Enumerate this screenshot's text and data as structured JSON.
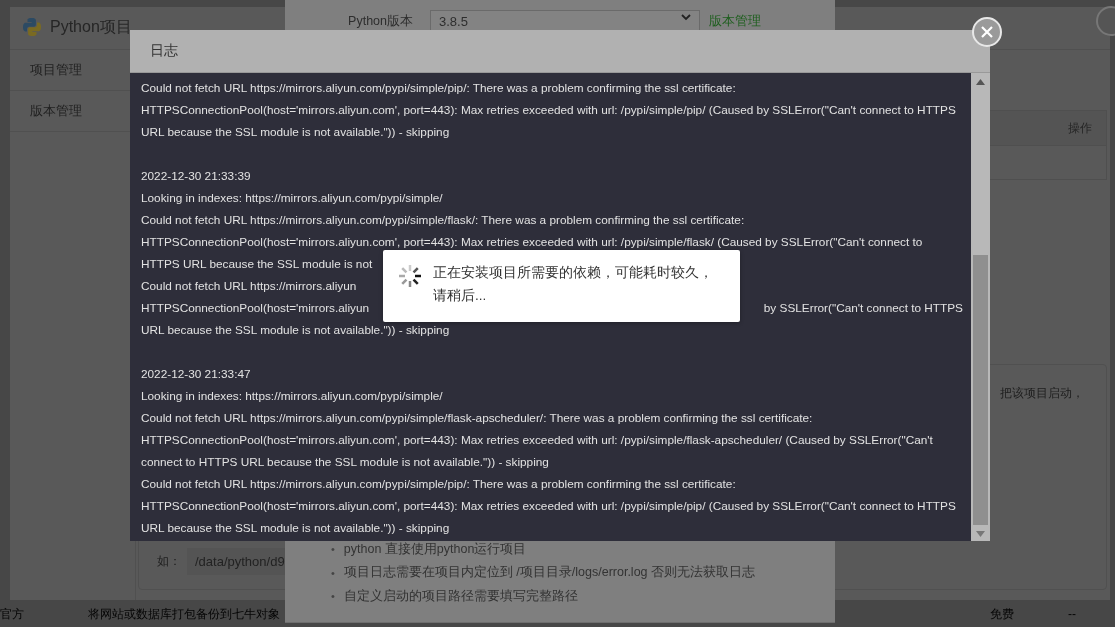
{
  "background_page": {
    "bottom_row": [
      "官方",
      "将网站或数据库打包备份到七牛对象",
      "免费",
      "--"
    ]
  },
  "manager_window": {
    "title": "Python项目",
    "sidebar": [
      {
        "label": "项目管理"
      },
      {
        "label": "版本管理"
      }
    ],
    "table": {
      "columns": [
        "操作"
      ]
    },
    "notice": "把该项目启动，",
    "path_example": {
      "label": "如：",
      "value": "/data/python/d9"
    }
  },
  "add_dialog": {
    "python_version": {
      "label": "Python版本",
      "value": "3.8.5"
    },
    "version_link": "版本管理",
    "tips": [
      {
        "bullet": "•",
        "text": "python 直接使用python运行项目"
      },
      {
        "bullet": "•",
        "text": "项目日志需要在项目内定位到 /项目目录/logs/error.log 否则无法获取日志"
      },
      {
        "bullet": "•",
        "text": "自定义启动的项目路径需要填写完整路径"
      }
    ]
  },
  "log_dialog": {
    "title": "日志",
    "blocks": [
      {
        "lines": [
          {
            "kind": "full",
            "text": "Could not fetch URL https://mirrors.aliyun.com/pypi/simple/pip/: There was a problem confirming the ssl certificate:"
          },
          {
            "kind": "full",
            "text": "HTTPSConnectionPool(host='mirrors.aliyun.com', port=443): Max retries exceeded with url: /pypi/simple/pip/ (Caused by SSLError(\"Can't connect to HTTPS"
          },
          {
            "kind": "full",
            "text": "URL because the SSL module is not available.\")) - skipping"
          }
        ]
      },
      {
        "lines": [
          {
            "kind": "full",
            "text": "2022-12-30 21:33:39"
          },
          {
            "kind": "full",
            "text": "Looking in indexes: https://mirrors.aliyun.com/pypi/simple/"
          },
          {
            "kind": "full",
            "text": "Could not fetch URL https://mirrors.aliyun.com/pypi/simple/flask/: There was a problem confirming the ssl certificate:"
          },
          {
            "kind": "full",
            "text": "HTTPSConnectionPool(host='mirrors.aliyun.com', port=443): Max retries exceeded with url: /pypi/simple/flask/ (Caused by SSLError(\"Can't connect to"
          },
          {
            "kind": "split",
            "left": "HTTPS URL because the SSL module is not"
          },
          {
            "kind": "split",
            "left": "Could not fetch URL https://mirrors.aliyun"
          },
          {
            "kind": "split",
            "left": "HTTPSConnectionPool(host='mirrors.aliyun",
            "right": "by SSLError(\"Can't connect to HTTPS"
          },
          {
            "kind": "full",
            "text": "URL because the SSL module is not available.\")) - skipping"
          }
        ]
      },
      {
        "lines": [
          {
            "kind": "full",
            "text": "2022-12-30 21:33:47"
          },
          {
            "kind": "full",
            "text": "Looking in indexes: https://mirrors.aliyun.com/pypi/simple/"
          },
          {
            "kind": "full",
            "text": "Could not fetch URL https://mirrors.aliyun.com/pypi/simple/flask-apscheduler/: There was a problem confirming the ssl certificate:"
          },
          {
            "kind": "full",
            "text": "HTTPSConnectionPool(host='mirrors.aliyun.com', port=443): Max retries exceeded with url: /pypi/simple/flask-apscheduler/ (Caused by SSLError(\"Can't"
          },
          {
            "kind": "full",
            "text": "connect to HTTPS URL because the SSL module is not available.\")) - skipping"
          },
          {
            "kind": "full",
            "text": "Could not fetch URL https://mirrors.aliyun.com/pypi/simple/pip/: There was a problem confirming the ssl certificate:"
          },
          {
            "kind": "full",
            "text": "HTTPSConnectionPool(host='mirrors.aliyun.com', port=443): Max retries exceeded with url: /pypi/simple/pip/ (Caused by SSLError(\"Can't connect to HTTPS"
          },
          {
            "kind": "full",
            "text": "URL because the SSL module is not available.\")) - skipping"
          }
        ]
      }
    ]
  },
  "loading_toast": {
    "message": "正在安装项目所需要的依赖，可能耗时较久，请稍后..."
  }
}
